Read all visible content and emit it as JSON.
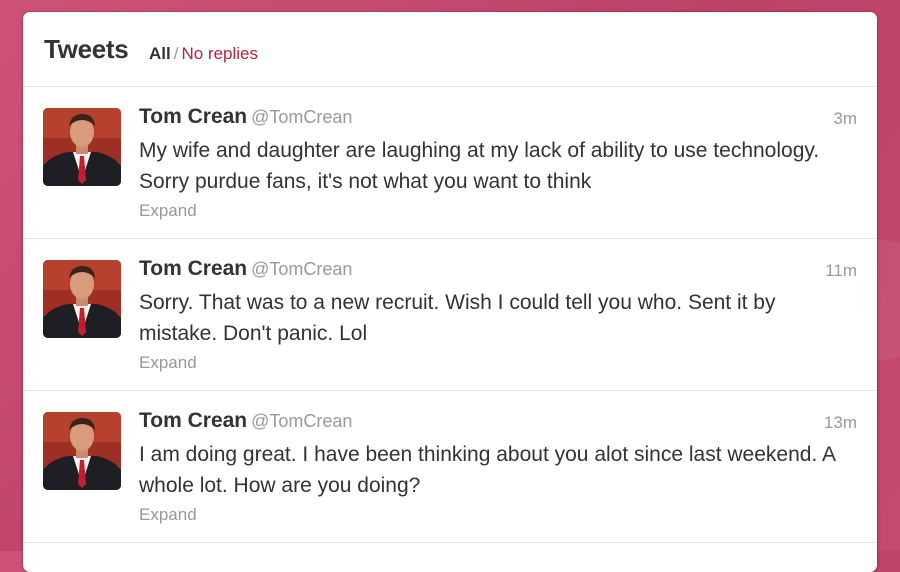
{
  "header": {
    "title": "Tweets",
    "filter_all": "All",
    "filter_separator": "/",
    "filter_no_replies": "No replies"
  },
  "tweets": [
    {
      "name": "Tom Crean",
      "handle": "@TomCrean",
      "time": "3m",
      "text": "My wife and daughter are laughing at my lack of ability to use technology. Sorry purdue fans, it's not what you want to think",
      "expand": "Expand"
    },
    {
      "name": "Tom Crean",
      "handle": "@TomCrean",
      "time": "11m",
      "text": "Sorry. That was to a new recruit. Wish I could tell you who. Sent it by mistake. Don't panic. Lol",
      "expand": "Expand"
    },
    {
      "name": "Tom Crean",
      "handle": "@TomCrean",
      "time": "13m",
      "text": "I am doing great. I have been thinking about you alot since last weekend. A whole lot. How are you doing?",
      "expand": "Expand"
    }
  ],
  "colors": {
    "background": "#c34a6e",
    "link_red": "#b3263c",
    "text": "#333333",
    "muted": "#999999"
  }
}
